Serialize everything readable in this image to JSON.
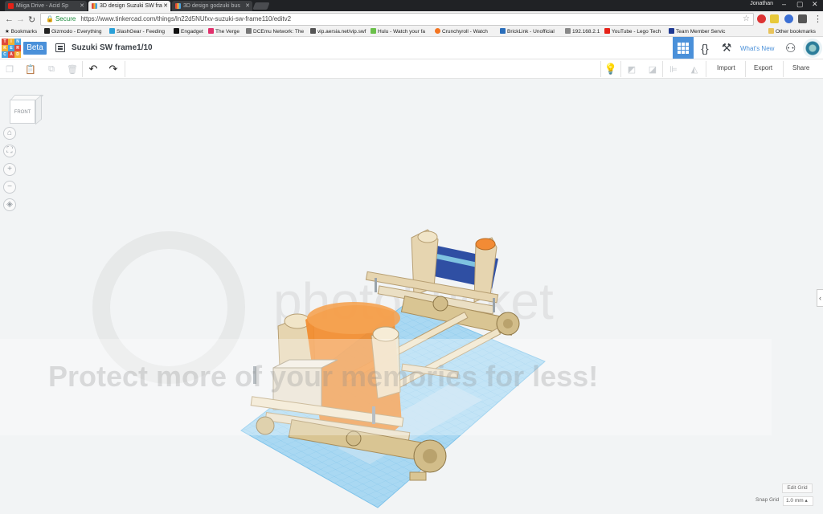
{
  "browser": {
    "tabs": [
      {
        "label": "Miiga Drive - Acid Sp",
        "active": false,
        "favicon_color": "#e62117"
      },
      {
        "label": "3D design Suzuki SW fra",
        "active": true,
        "favicon_color": "#e7a33e"
      },
      {
        "label": "3D design godzuki bus",
        "active": false,
        "favicon_color": "#e7a33e"
      }
    ],
    "profile_name": "Jonathan",
    "address": {
      "secure_label": "Secure",
      "url": "https://www.tinkercad.com/things/ln22d5NUfxv-suzuki-sw-frame110/editv2"
    },
    "bookmarks_label": "Bookmarks",
    "bookmarks": [
      {
        "label": "Gizmodo - Everything",
        "color": "#222222"
      },
      {
        "label": "SlashGear - Feeding",
        "color": "#2aa0d8"
      },
      {
        "label": "Engadget",
        "color": "#111111"
      },
      {
        "label": "The Verge",
        "color": "#e1306c"
      },
      {
        "label": "DCEmu Network: The",
        "color": "#777777"
      },
      {
        "label": "vip.aersia.net/vip.swf",
        "color": "#555555"
      },
      {
        "label": "Hulu - Watch your fa",
        "color": "#6bc04b"
      },
      {
        "label": "Crunchyroll - Watch",
        "color": "#f47521"
      },
      {
        "label": "BrickLink - Unofficial",
        "color": "#2a6ebb"
      },
      {
        "label": "192.168.2.1",
        "color": "#888888"
      },
      {
        "label": "YouTube - Lego Tech",
        "color": "#e62117"
      },
      {
        "label": "Team Member Servic",
        "color": "#1f3a93"
      }
    ],
    "other_bookmarks": "Other bookmarks"
  },
  "app": {
    "logo_letters": [
      "T",
      "I",
      "N",
      "K",
      "E",
      "R",
      "C",
      "A",
      "D"
    ],
    "beta_label": "Beta",
    "design_title": "Suzuki SW frame1/10",
    "whats_new": "What's New",
    "accent": "#4a90d9"
  },
  "toolbar": {
    "import_label": "Import",
    "export_label": "Export",
    "share_label": "Share"
  },
  "workplane": {
    "viewcube_label": "FRONT",
    "edit_grid_label": "Edit Grid",
    "snap_grid_label": "Snap Grid",
    "snap_grid_value": "1.0 mm ▴",
    "watermark_text": "Protect more of your memories for less!",
    "watermark_brand": "photobucket"
  }
}
